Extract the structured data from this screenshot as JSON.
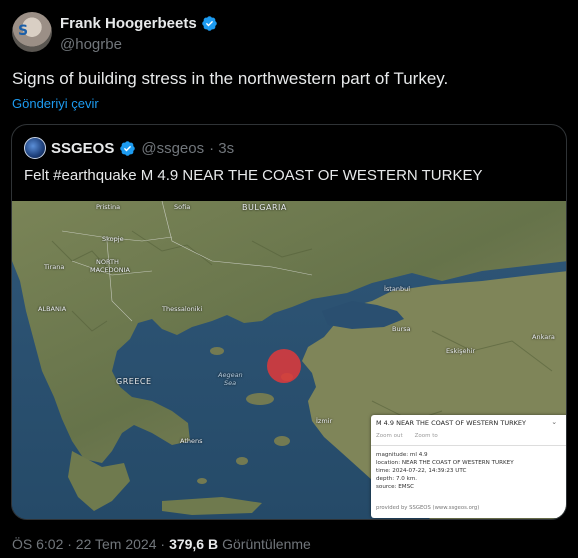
{
  "author": {
    "display_name": "Frank Hoogerbeets",
    "handle": "@hogrbe",
    "avatar_letter": "S"
  },
  "tweet": {
    "text": "Signs of building stress in the northwestern part of Turkey.",
    "translate_label": "Gönderiyi çevir"
  },
  "quoted": {
    "display_name": "SSGEOS",
    "handle": "@ssgeos",
    "time": "· 3s",
    "text": "Felt #earthquake M 4.9 NEAR THE COAST OF WESTERN TURKEY"
  },
  "map": {
    "labels": {
      "pristina": "Pristina",
      "sofia": "Sofia",
      "bulgaria": "BULGARIA",
      "skopje": "Skopje",
      "tirana": "Tirana",
      "north_macedonia_1": "NORTH",
      "north_macedonia_2": "MACEDONIA",
      "albania": "ALBANIA",
      "thessaloniki": "Thessaloniki",
      "greece": "GREECE",
      "aegean_1": "Aegean",
      "aegean_2": "Sea",
      "athens": "Athens",
      "istanbul": "İstanbul",
      "bursa": "Bursa",
      "eskisehir": "Eskişehir",
      "ankara": "Ankara",
      "izmir": "İzmir"
    },
    "popup": {
      "title": "M 4.9 NEAR THE COAST OF WESTERN TURKEY",
      "btn_min": "⌄",
      "btn_close": "×",
      "zoom_out": "Zoom out",
      "zoom_in": "Zoom to",
      "magnitude": "magnitude: ml 4.9",
      "location": "location: NEAR THE COAST OF WESTERN TURKEY",
      "time": "time: 2024-07-22, 14:39:23 UTC",
      "depth": "depth: 7.0 km.",
      "source": "source: EMSC",
      "provided": "provided by SSGEOS (www.ssgeos.org)"
    },
    "colors": {
      "sea": "#2d5473",
      "land": "#6e7a4f",
      "marker": "#e0383b"
    }
  },
  "footer": {
    "time": "ÖS 6:02 · 22 Tem 2024 ·",
    "views_count": "379,6 B",
    "views_label": "Görüntülenme"
  },
  "colors": {
    "accent": "#1d9bf0",
    "muted": "#71767b",
    "text": "#e7e9ea"
  }
}
